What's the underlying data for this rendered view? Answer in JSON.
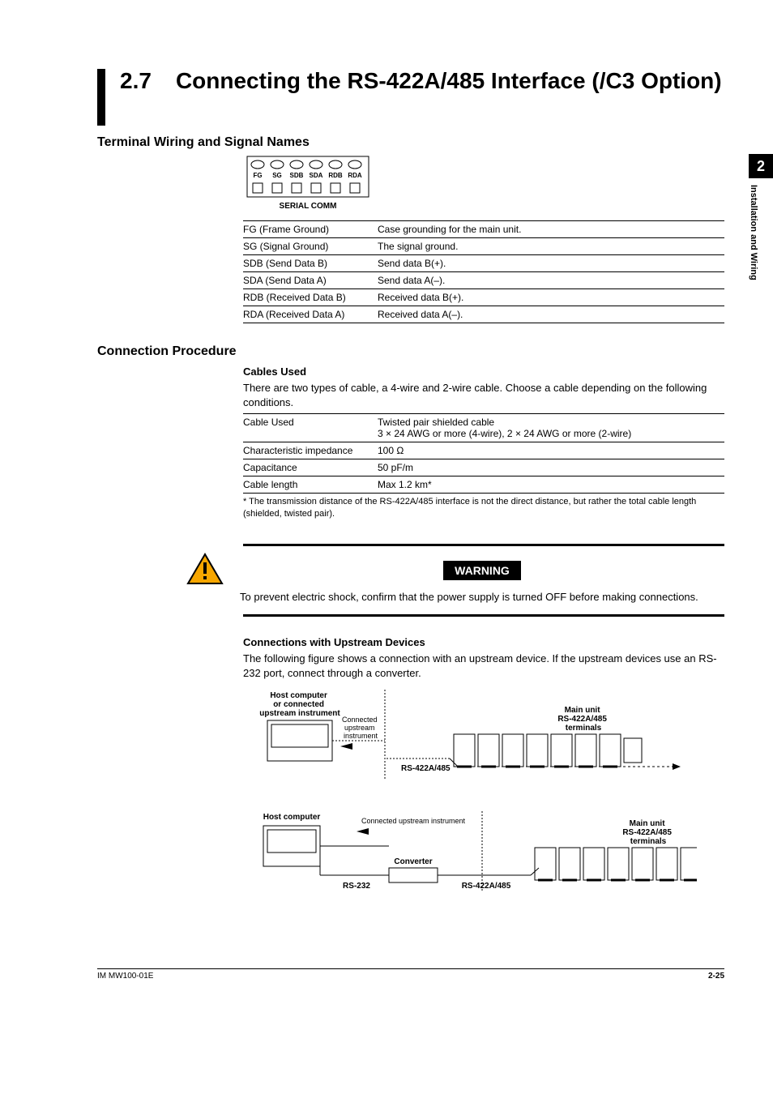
{
  "side_tab": {
    "num": "2",
    "text": "Installation and Wiring"
  },
  "title": {
    "num": "2.7",
    "text": "Connecting the RS-422A/485 Interface (/C3 Option)"
  },
  "h2_1": "Terminal Wiring and Signal Names",
  "terminal_labels": [
    "FG",
    "SG",
    "SDB",
    "SDA",
    "RDB",
    "RDA"
  ],
  "terminal_caption": "SERIAL COMM",
  "signal_table": [
    [
      "FG (Frame Ground)",
      "Case grounding for the main unit."
    ],
    [
      "SG (Signal Ground)",
      "The signal ground."
    ],
    [
      "SDB (Send Data B)",
      "Send data B(+)."
    ],
    [
      "SDA (Send Data A)",
      "Send data A(–)."
    ],
    [
      "RDB (Received Data B)",
      "Received data B(+)."
    ],
    [
      "RDA (Received Data A)",
      "Received data A(–)."
    ]
  ],
  "h2_2": "Connection Procedure",
  "h3_cables": "Cables Used",
  "cables_para": "There are two types of cable, a 4-wire and 2-wire cable. Choose a cable depending on the following conditions.",
  "cable_table": [
    [
      "Cable Used",
      "Twisted pair shielded cable\n3 × 24 AWG or more (4-wire), 2 × 24 AWG or more (2-wire)"
    ],
    [
      "Characteristic impedance",
      "100 Ω"
    ],
    [
      "Capacitance",
      "50 pF/m"
    ],
    [
      "Cable length",
      "Max 1.2 km*"
    ]
  ],
  "cable_footnote": "* The transmission distance of the RS-422A/485 interface is not the direct distance, but rather the total cable length (shielded, twisted pair).",
  "warning_label": "WARNING",
  "warning_text": "To prevent electric shock, confirm that the power supply is turned OFF before making connections.",
  "h3_upstream": "Connections with Upstream Devices",
  "upstream_para": "The following figure shows a connection with an upstream device. If the upstream devices use an RS-232 port, connect through a converter.",
  "fig": {
    "host1": "Host computer\nor connected\nupstream instrument",
    "connected_upstream": "Connected\nupstream\ninstrument",
    "rs422": "RS-422A/485",
    "main_unit": "Main unit\nRS-422A/485\nterminals",
    "host2": "Host computer",
    "connected_upstream2": "Connected upstream instrument",
    "converter": "Converter",
    "rs232": "RS-232"
  },
  "footer": {
    "left": "IM MW100-01E",
    "right": "2-25"
  }
}
